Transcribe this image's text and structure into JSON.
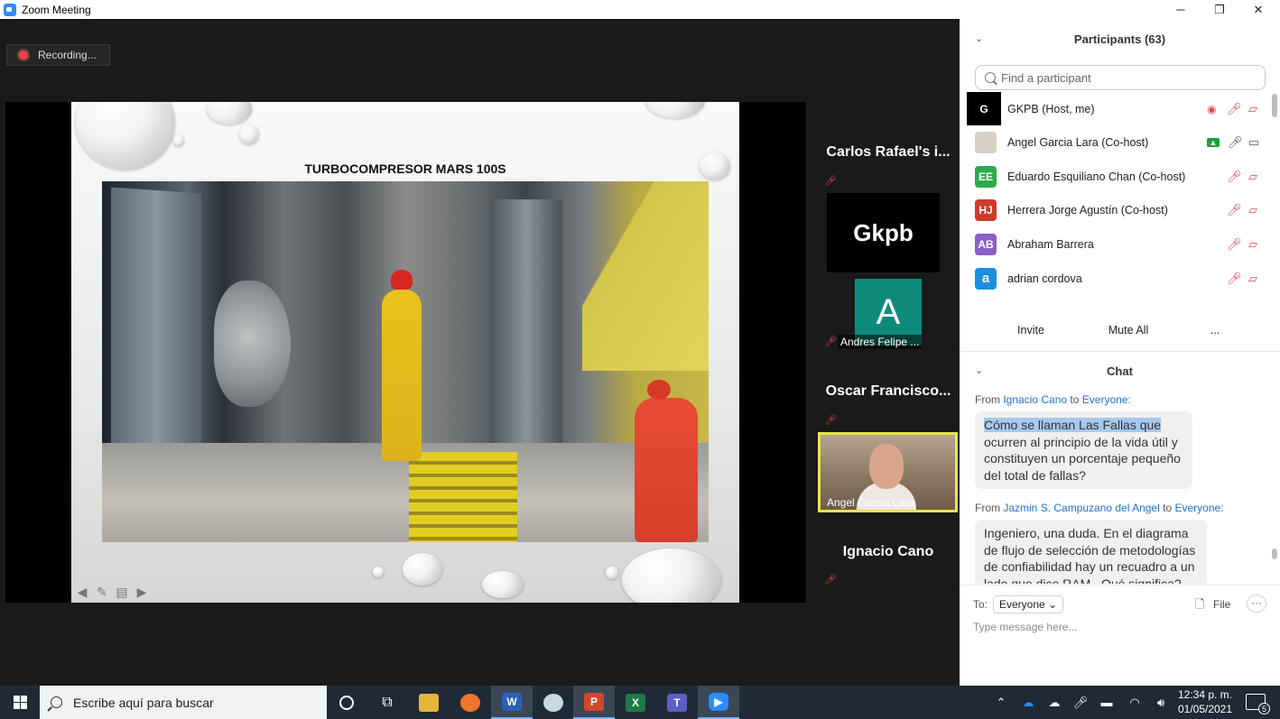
{
  "window": {
    "title": "Zoom Meeting",
    "minimize": "─",
    "restore": "❐",
    "close": "✕"
  },
  "recording": {
    "label": "Recording..."
  },
  "slide": {
    "title": "TURBOCOMPRESOR MARS 100S"
  },
  "gallery": [
    {
      "name": "Carlos Rafael's i..."
    },
    {
      "name": "Gkpb"
    },
    {
      "initial": "A",
      "name": "Andres Felipe ..."
    },
    {
      "name": "Oscar Francisco..."
    },
    {
      "name": "Angel Garcia Lara"
    },
    {
      "name": "Ignacio Cano"
    }
  ],
  "participants": {
    "title": "Participants (63)",
    "search_placeholder": "Find a participant",
    "list": [
      {
        "initials": "G",
        "name": "GKPB (Host, me)",
        "color": "#000000"
      },
      {
        "initials": "",
        "name": "Angel Garcia Lara (Co-host)",
        "color": "#c9c0b5"
      },
      {
        "initials": "EE",
        "name": "Eduardo Esquiliano Chan (Co-host)",
        "color": "#2eaa4c"
      },
      {
        "initials": "HJ",
        "name": "Herrera Jorge Agustín (Co-host)",
        "color": "#d1392c"
      },
      {
        "initials": "AB",
        "name": "Abraham Barrera",
        "color": "#8b5fc7"
      },
      {
        "initials": "a",
        "name": "adrian cordova",
        "color": "#1a8fe0"
      }
    ],
    "invite": "Invite",
    "mute_all": "Mute All",
    "more": "..."
  },
  "chat": {
    "title": "Chat",
    "messages": [
      {
        "from_label": "From",
        "sender": "Ignacio Cano",
        "to_label": "to",
        "recipient": "Everyone:",
        "highlight": "Cómo se llaman Las Fallas que",
        "lines": [
          "ocurren al principio de la vida útil y",
          "constituyen un porcentaje pequeño",
          "del total de fallas?"
        ]
      },
      {
        "from_label": "From",
        "sender": "Jazmin S. Campuzano del Angel",
        "to_label": "to",
        "recipient": "Everyone:",
        "highlight": "",
        "lines": [
          "Ingeniero, una duda. En el diagrama",
          "de flujo de selección de metodologías",
          "de confiabilidad hay un recuadro a un",
          "lado que dice RAM . Qué significa?"
        ]
      }
    ],
    "to_label": "To:",
    "to_value": "Everyone",
    "file_label": "File",
    "more": "···",
    "placeholder": "Type message here..."
  },
  "taskbar": {
    "search_text": "Escribe aquí para buscar",
    "time": "12:34 p. m.",
    "date": "01/05/2021",
    "notifications": "5"
  }
}
